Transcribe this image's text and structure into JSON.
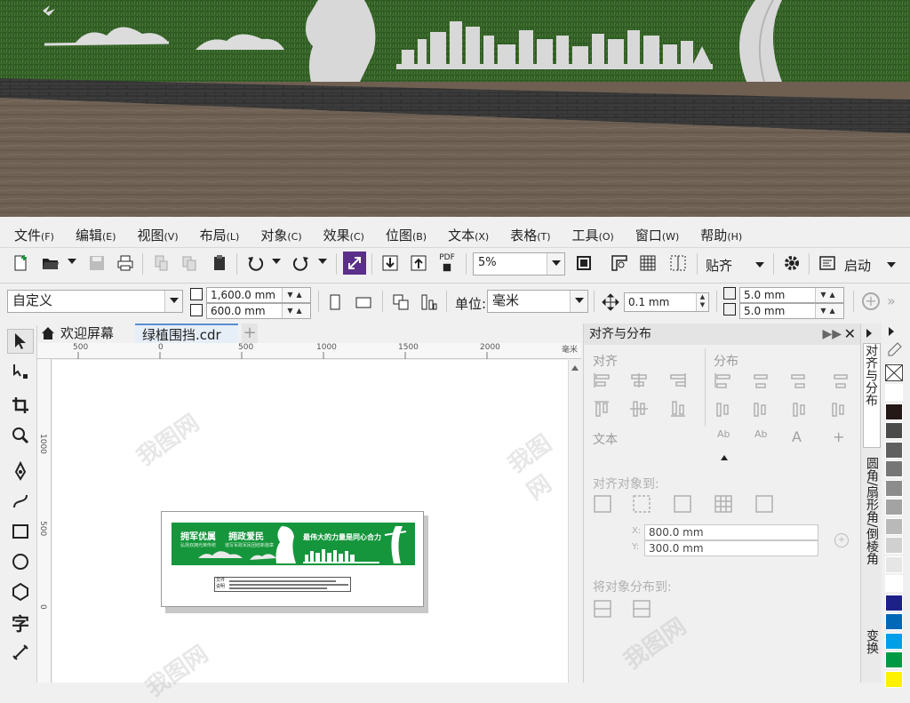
{
  "scene": {
    "caption_left_hidden": "",
    "caption_right_hidden": ""
  },
  "menubar": {
    "items": [
      {
        "label": "文件",
        "acc": "(F)"
      },
      {
        "label": "编辑",
        "acc": "(E)"
      },
      {
        "label": "视图",
        "acc": "(V)"
      },
      {
        "label": "布局",
        "acc": "(L)"
      },
      {
        "label": "对象",
        "acc": "(C)"
      },
      {
        "label": "效果",
        "acc": "(C)"
      },
      {
        "label": "位图",
        "acc": "(B)"
      },
      {
        "label": "文本",
        "acc": "(X)"
      },
      {
        "label": "表格",
        "acc": "(T)"
      },
      {
        "label": "工具",
        "acc": "(O)"
      },
      {
        "label": "窗口",
        "acc": "(W)"
      },
      {
        "label": "帮助",
        "acc": "(H)"
      }
    ]
  },
  "toolbar": {
    "pdf_label": "PDF",
    "zoom_value": "5%",
    "snap_label": "贴齐",
    "launch_label": "启动"
  },
  "propertybar": {
    "page_size": "自定义",
    "width": "1,600.0 mm",
    "height": "600.0 mm",
    "units_label": "单位:",
    "units_value": "毫米",
    "nudge": "0.1 mm",
    "dup_x": "5.0 mm",
    "dup_y": "5.0 mm"
  },
  "tabs": {
    "welcome": "欢迎屏幕",
    "document": "绿植围挡.cdr",
    "add": "+"
  },
  "ruler": {
    "top_labels": [
      "500",
      "0",
      "500",
      "1000",
      "1500",
      "2000"
    ],
    "unit": "毫米",
    "left_labels": [
      "1000",
      "500",
      "0"
    ]
  },
  "artwork": {
    "slogan_1": "拥军优属",
    "slogan_2": "拥政爱民",
    "slogan_3": "最伟大的力量是同心合力",
    "small_text_1": "弘扬双拥光荣传统",
    "small_text_2": "谱写军政军民团结新篇章",
    "note_line_1": "文件",
    "note_line_2": "说明"
  },
  "panel": {
    "title": "对齐与分布",
    "section_align": "对齐",
    "section_distribute": "分布",
    "section_text": "文本",
    "align_to": "对齐对象到:",
    "x_label": "X:",
    "x_value": "800.0 mm",
    "y_label": "Y:",
    "y_value": "300.0 mm",
    "distribute_to": "将对象分布到:"
  },
  "side_tabs": {
    "tab1": "对齐与分布",
    "tab2": "圆角/扇形角/倒棱角",
    "tab3": "变换"
  },
  "palette": {
    "colors": [
      "#ffffff",
      "#231815",
      "#4a4a4a",
      "#5f5f5f",
      "#767676",
      "#8c8c8c",
      "#a3a3a3",
      "#b9b9b9",
      "#d0d0d0",
      "#e6e6e6",
      "#ffffff",
      "#1d2088",
      "#0068b7",
      "#00a0e9",
      "#009944",
      "#fff100"
    ]
  },
  "colors": {
    "artwork_green": "#15963c",
    "grass": "#2f5a24",
    "ground": "#6e5f51"
  }
}
